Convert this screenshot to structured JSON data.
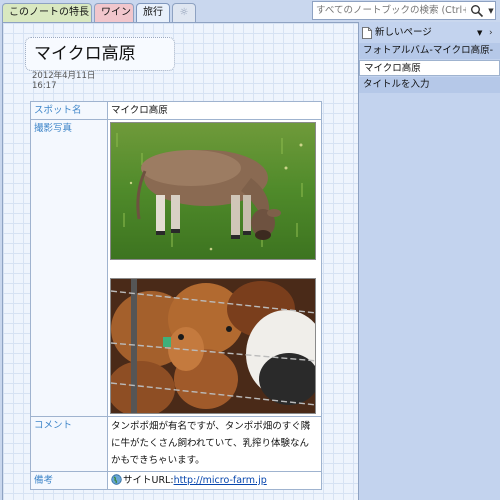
{
  "tabs": [
    {
      "label": "このノートの特長"
    },
    {
      "label": "ワイン"
    },
    {
      "label": "旅行"
    },
    {
      "label": "☼"
    }
  ],
  "search": {
    "placeholder": "すべてのノートブックの検索 (Ctrl+E)"
  },
  "page": {
    "title": "マイクロ高原",
    "date": "2012年4月11日",
    "time": "16:17"
  },
  "table": {
    "spot_label": "スポット名",
    "spot_value": "マイクロ高原",
    "photo_label": "撮影写真",
    "comment_label": "コメント",
    "comment_text": "タンポポ畑が有名ですが、タンポポ畑のすぐ隣に牛がたくさん飼われていて、乳搾り体験なんかもできちゃいます。",
    "note_label": "備考",
    "site_prefix": "サイトURL:",
    "site_url": "http://micro-farm.jp"
  },
  "sidebar": {
    "new_page": "新しいページ",
    "pages": [
      {
        "label": "フォトアルバム-マイクロ高原-"
      },
      {
        "label": "マイクロ高原"
      },
      {
        "label": "タイトルを入力"
      }
    ]
  },
  "colors": {
    "accent_label": "#3f86c9",
    "link": "#0645ad",
    "selected_page": "#ffffff",
    "sidebar_bg": "#c3d3ee"
  },
  "icons": [
    "search-icon",
    "dropdown-icon",
    "new-page-icon",
    "globe-icon",
    "chevron-right-icon"
  ]
}
